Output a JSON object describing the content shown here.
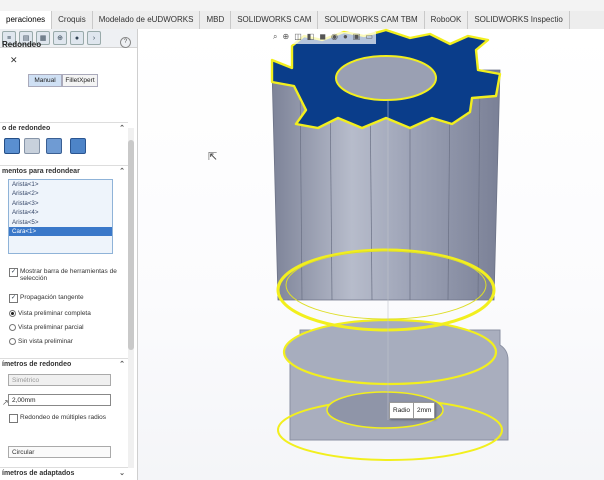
{
  "tabs": [
    "peraciones",
    "Croquis",
    "Modelado de eUDWORKS",
    "MBD",
    "SOLIDWORKS CAM",
    "SOLIDWORKS CAM TBM",
    "RoboOK",
    "SOLIDWORKS Inspectio"
  ],
  "panel": {
    "title": "Redondeo",
    "close": "✕",
    "help": "?",
    "modes": [
      "Manual",
      "FilletXpert"
    ],
    "sections": {
      "fillet_type": "o de redondeo",
      "items": "mentos para redondear",
      "params": "ímetros de redondeo",
      "setback": "ímetros de adaptados"
    },
    "items": [
      "Arista<1>",
      "Arista<2>",
      "Arista<3>",
      "Arista<4>",
      "Arista<5>",
      "Cara<1>"
    ],
    "selected_item": "Cara<1>",
    "options": {
      "show_toolbar": "Mostrar barra de herramientas de selección",
      "tangent": "Propagación tangente",
      "full_preview": "Vista preliminar completa",
      "partial_preview": "Vista preliminar parcial",
      "no_preview": "Sin vista preliminar",
      "multi_radius": "Redondeo de múltiples radios"
    },
    "symmetric": "Simétrico",
    "radius": "2,00mm",
    "profile": "Circular"
  },
  "viewport": {
    "radius_label": "Radio",
    "radius_value": "2mm"
  },
  "colors": {
    "gear_blue": "#0a3d8a",
    "highlight": "#f2ef1e",
    "body": "#9aa0b4"
  }
}
